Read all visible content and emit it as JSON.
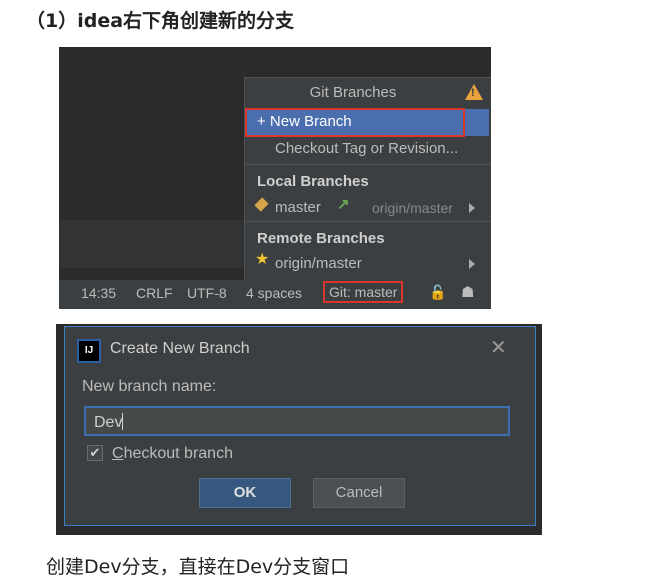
{
  "heading": "（1）idea右下角创建新的分支",
  "caption": "创建Dev分支，直接在Dev分支窗口",
  "git_popup": {
    "title": "Git Branches",
    "new_branch": "+ New Branch",
    "checkout_tag": "Checkout Tag or Revision...",
    "local_section": "Local Branches",
    "local_branch": "master",
    "local_tracking": "origin/master",
    "remote_section": "Remote Branches",
    "remote_branch": "origin/master"
  },
  "status_bar": {
    "time": "14:35",
    "line_sep": "CRLF",
    "encoding": "UTF-8",
    "indent": "4 spaces",
    "git": "Git: master"
  },
  "dialog": {
    "logo": "IJ",
    "title": "Create New Branch",
    "field_label": "New branch name:",
    "field_value": "Dev",
    "checkbox_label": "Checkout branch",
    "checkbox_checked": true,
    "ok_label": "OK",
    "cancel_label": "Cancel"
  },
  "colors": {
    "highlight_red": "#d9362e",
    "selection_blue": "#4b6eaf",
    "warning": "#e8a33d"
  }
}
